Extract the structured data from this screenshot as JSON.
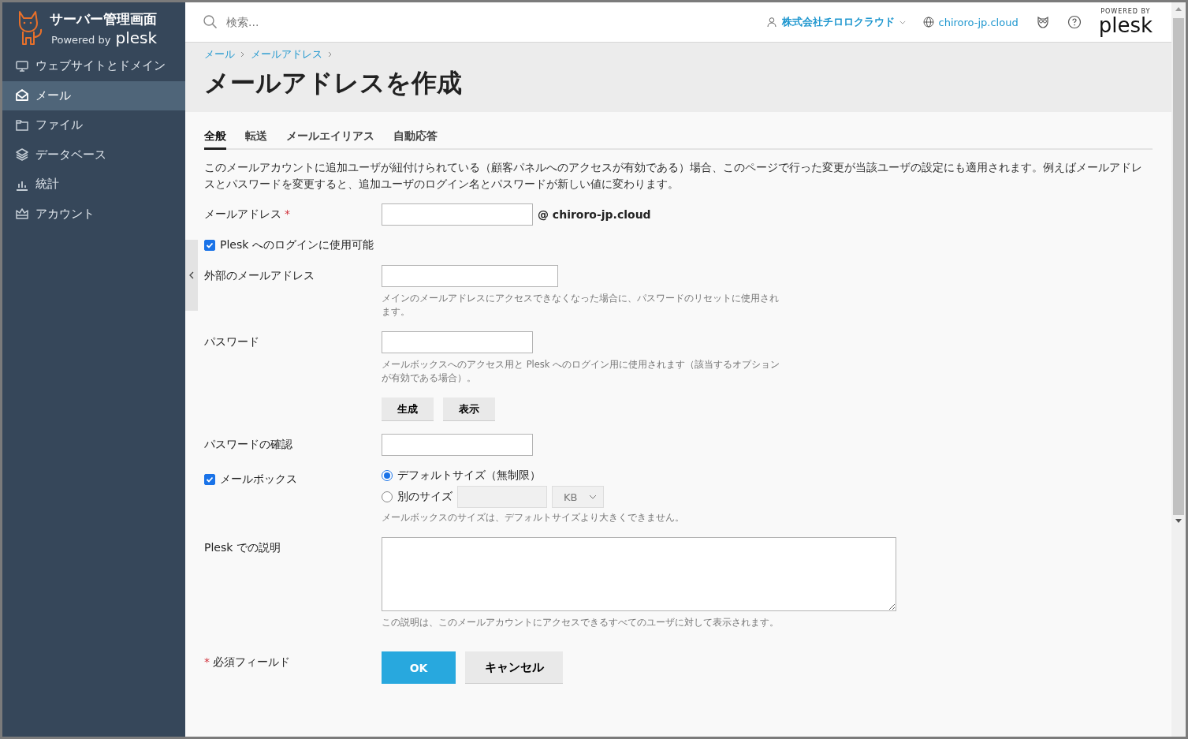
{
  "sidebar": {
    "logo_title": "サーバー管理画面",
    "logo_powered": "Powered by",
    "logo_brand": "plesk",
    "items": [
      {
        "label": "ウェブサイトとドメイン",
        "selected": false
      },
      {
        "label": "メール",
        "selected": true
      },
      {
        "label": "ファイル",
        "selected": false
      },
      {
        "label": "データベース",
        "selected": false
      },
      {
        "label": "統計",
        "selected": false
      },
      {
        "label": "アカウント",
        "selected": false
      }
    ]
  },
  "header": {
    "search": {
      "placeholder": "検索..."
    },
    "account": "株式会社チロロクラウド",
    "domain": "chiroro-jp.cloud",
    "badge_top": "POWERED BY",
    "badge_brand": "plesk"
  },
  "breadcrumbs": [
    "メール",
    "メールアドレス"
  ],
  "title": "メールアドレスを作成",
  "tabs": [
    {
      "label": "全般",
      "selected": true
    },
    {
      "label": "転送",
      "selected": false
    },
    {
      "label": "メールエイリアス",
      "selected": false
    },
    {
      "label": "自動応答",
      "selected": false
    }
  ],
  "intro": "このメールアカウントに追加ユーザが紐付けられている（顧客パネルへのアクセスが有効である）場合、このページで行った変更が当該ユーザの設定にも適用されます。例えばメールアドレスとパスワードを変更すると、追加ユーザのログイン名とパスワードが新しい値に変わります。",
  "form": [
    {
      "kind": "text",
      "label": "メールアドレス",
      "required_mark": "*",
      "suffix": "@ chiroro-jp.cloud"
    },
    {
      "kind": "checkbox",
      "label": "Plesk へのログインに使用可能",
      "checked": true
    },
    {
      "kind": "text",
      "label": "外部のメールアドレス",
      "hint": "メインのメールアドレスにアクセスできなくなった場合に、パスワードのリセットに使用されます。"
    },
    {
      "kind": "text",
      "label": "パスワード",
      "hint": "メールボックスへのアクセス用と Plesk へのログイン用に使用されます（該当するオプションが有効である場合）。",
      "buttons": [
        "生成",
        "表示"
      ]
    },
    {
      "kind": "text",
      "label": "パスワードの確認"
    },
    {
      "kind": "mailbox",
      "label": "メールボックス",
      "checked": true,
      "options": [
        {
          "label": "デフォルトサイズ（無制限）",
          "selected": true
        },
        {
          "label": "別のサイズ",
          "selected": false
        }
      ],
      "unit": "KB",
      "hint": "メールボックスのサイズは、デフォルトサイズより大きくできません。"
    },
    {
      "kind": "textarea",
      "label": "Plesk での説明",
      "hint": "この説明は、このメールアカウントにアクセスできるすべてのユーザに対して表示されます。"
    }
  ],
  "footer": {
    "required_mark": "*",
    "required_note": "必須フィールド",
    "ok": "OK",
    "cancel": "キャンセル"
  }
}
